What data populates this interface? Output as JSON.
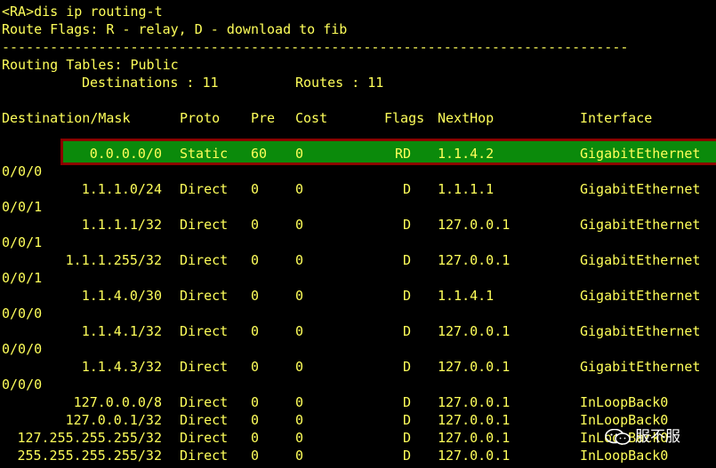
{
  "command_line": "<RA>dis ip routing-t",
  "route_flags_legend": "Route Flags: R - relay, D - download to fib",
  "separator": "------------------------------------------------------------------------------",
  "routing_tables_label": "Routing Tables: Public",
  "destinations_summary": "Destinations : 11",
  "routes_summary": "Routes : 11",
  "headers": {
    "destination": "Destination/Mask",
    "proto": "Proto",
    "pre": "Pre",
    "cost": "Cost",
    "flags": "Flags",
    "nexthop": "NextHop",
    "interface": "Interface"
  },
  "routes": [
    {
      "destination": "0.0.0.0/0",
      "proto": "Static",
      "pre": "60",
      "cost": "0",
      "flags": "RD",
      "nexthop": "1.1.4.2",
      "interface": "GigabitEthernet",
      "interface_cont": "0/0/0",
      "highlighted": true
    },
    {
      "destination": "1.1.1.0/24",
      "proto": "Direct",
      "pre": "0",
      "cost": "0",
      "flags": "D",
      "nexthop": "1.1.1.1",
      "interface": "GigabitEthernet",
      "interface_cont": "0/0/1"
    },
    {
      "destination": "1.1.1.1/32",
      "proto": "Direct",
      "pre": "0",
      "cost": "0",
      "flags": "D",
      "nexthop": "127.0.0.1",
      "interface": "GigabitEthernet",
      "interface_cont": "0/0/1"
    },
    {
      "destination": "1.1.1.255/32",
      "proto": "Direct",
      "pre": "0",
      "cost": "0",
      "flags": "D",
      "nexthop": "127.0.0.1",
      "interface": "GigabitEthernet",
      "interface_cont": "0/0/1"
    },
    {
      "destination": "1.1.4.0/30",
      "proto": "Direct",
      "pre": "0",
      "cost": "0",
      "flags": "D",
      "nexthop": "1.1.4.1",
      "interface": "GigabitEthernet",
      "interface_cont": "0/0/0"
    },
    {
      "destination": "1.1.4.1/32",
      "proto": "Direct",
      "pre": "0",
      "cost": "0",
      "flags": "D",
      "nexthop": "127.0.0.1",
      "interface": "GigabitEthernet",
      "interface_cont": "0/0/0"
    },
    {
      "destination": "1.1.4.3/32",
      "proto": "Direct",
      "pre": "0",
      "cost": "0",
      "flags": "D",
      "nexthop": "127.0.0.1",
      "interface": "GigabitEthernet",
      "interface_cont": "0/0/0"
    },
    {
      "destination": "127.0.0.0/8",
      "proto": "Direct",
      "pre": "0",
      "cost": "0",
      "flags": "D",
      "nexthop": "127.0.0.1",
      "interface": "InLoopBack0"
    },
    {
      "destination": "127.0.0.1/32",
      "proto": "Direct",
      "pre": "0",
      "cost": "0",
      "flags": "D",
      "nexthop": "127.0.0.1",
      "interface": "InLoopBack0"
    },
    {
      "destination": "127.255.255.255/32",
      "proto": "Direct",
      "pre": "0",
      "cost": "0",
      "flags": "D",
      "nexthop": "127.0.0.1",
      "interface": "InLoopBack0"
    },
    {
      "destination": "255.255.255.255/32",
      "proto": "Direct",
      "pre": "0",
      "cost": "0",
      "flags": "D",
      "nexthop": "127.0.0.1",
      "interface": "InLoopBack0"
    }
  ],
  "watermark_text": "服不服",
  "colors": {
    "text": "#ffff5a",
    "highlight_fill": "#0b8a0b",
    "highlight_border": "#8b0000"
  }
}
